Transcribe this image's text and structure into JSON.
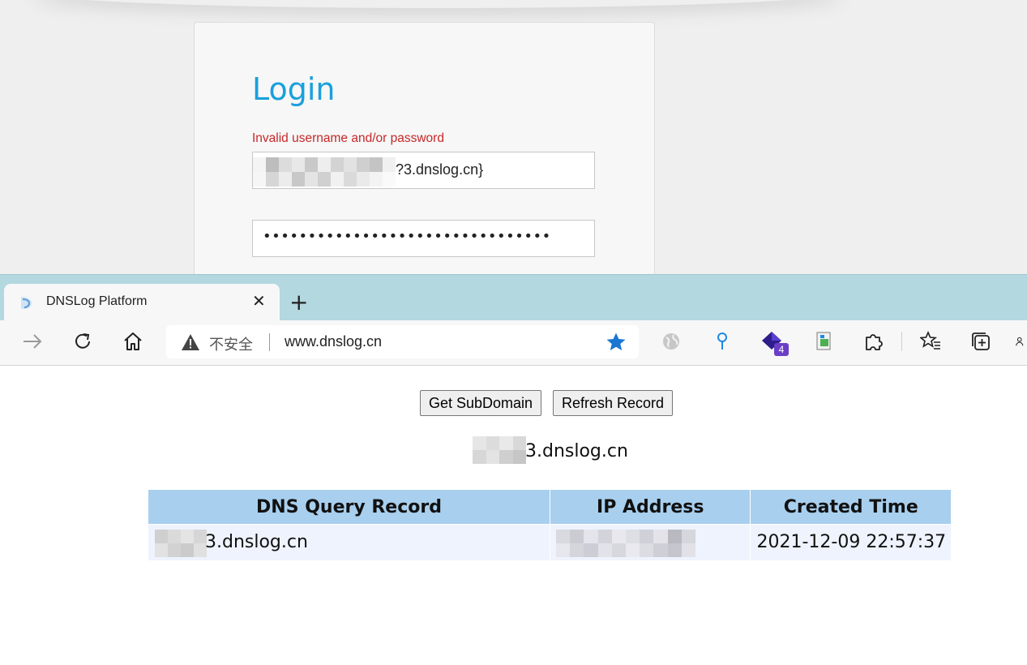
{
  "login": {
    "title": "Login",
    "error": "Invalid username and/or password",
    "username_value": "?3.dnslog.cn}",
    "password_value": "••••••••••••••••••••••••••••••••"
  },
  "browser": {
    "tab_title": "DNSLog Platform",
    "tab_close": "✕",
    "new_tab": "+",
    "insecure_label": "不安全",
    "url": "www.dnslog.cn",
    "extension_badge": "4",
    "icons": [
      "forward-icon",
      "refresh-icon",
      "home-icon",
      "warning-icon",
      "favorite-star-icon",
      "globe-icon",
      "pin-icon",
      "extension-diamond-icon",
      "sheet-icon",
      "puzzle-icon",
      "favorites-icon",
      "collections-icon",
      "profile-icon"
    ]
  },
  "page": {
    "get_subdomain_label": "Get SubDomain",
    "refresh_label": "Refresh Record",
    "subdomain": "3.dnslog.cn",
    "table": {
      "headers": [
        "DNS Query Record",
        "IP Address",
        "Created Time"
      ],
      "rows": [
        {
          "dns": "3.dnslog.cn",
          "ip": "",
          "time": "2021-12-09 22:57:37"
        }
      ]
    }
  },
  "colors": {
    "title_blue": "#1aa0dc",
    "error_red": "#c62828",
    "tab_strip": "#b3d8e0",
    "header_cell": "#a8cfee",
    "row_cell": "#eef3fd",
    "star_blue": "#1976d2"
  }
}
